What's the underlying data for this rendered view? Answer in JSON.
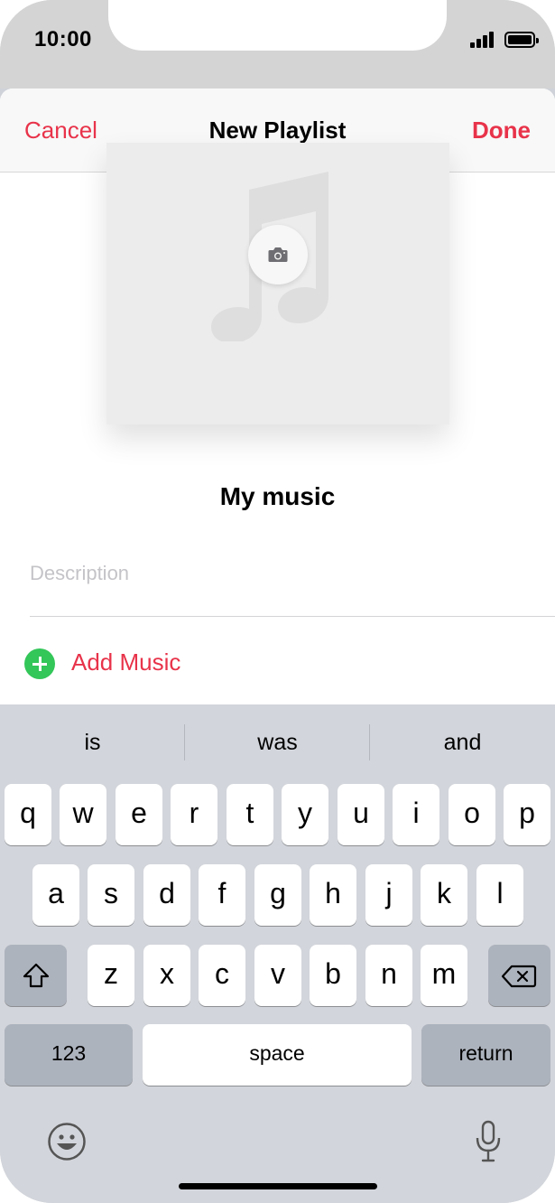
{
  "status_bar": {
    "time": "10:00"
  },
  "nav": {
    "cancel": "Cancel",
    "title": "New Playlist",
    "done": "Done"
  },
  "playlist": {
    "name": "My music",
    "description_placeholder": "Description",
    "add_music": "Add Music"
  },
  "keyboard": {
    "suggestions": [
      "is",
      "was",
      "and"
    ],
    "row1": [
      "q",
      "w",
      "e",
      "r",
      "t",
      "y",
      "u",
      "i",
      "o",
      "p"
    ],
    "row2": [
      "a",
      "s",
      "d",
      "f",
      "g",
      "h",
      "j",
      "k",
      "l"
    ],
    "row3": [
      "z",
      "x",
      "c",
      "v",
      "b",
      "n",
      "m"
    ],
    "numbers_key": "123",
    "space_key": "space",
    "return_key": "return"
  },
  "colors": {
    "accent": "#e8334a",
    "add_green": "#33c659",
    "keyboard_bg": "#d2d5db"
  }
}
